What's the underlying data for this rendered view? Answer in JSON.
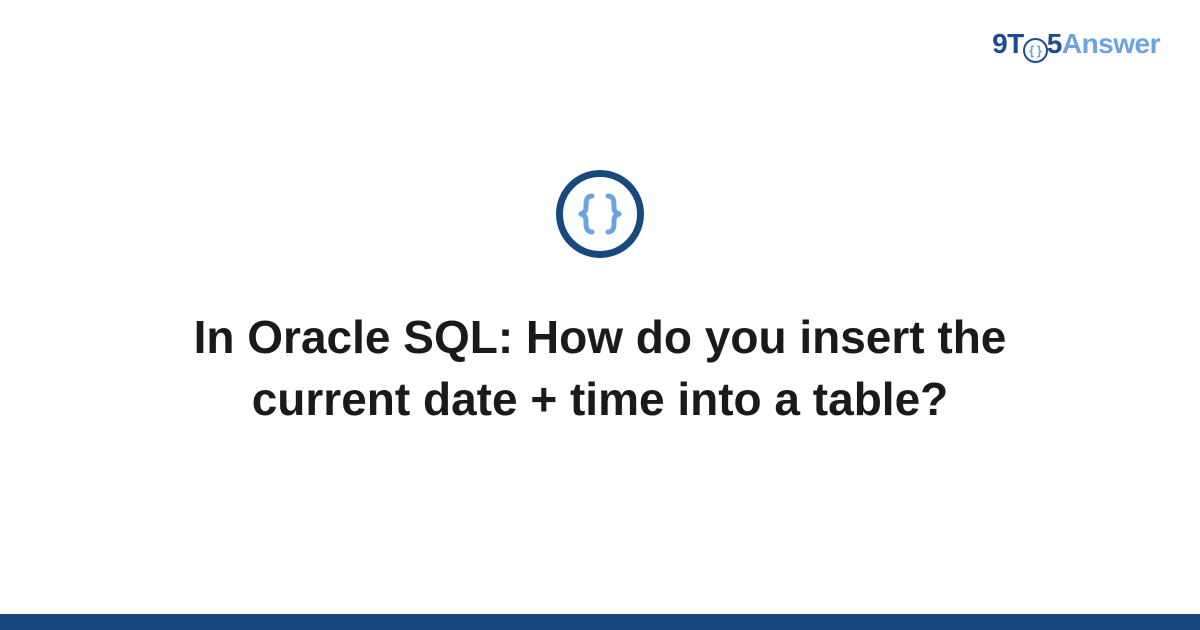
{
  "brand": {
    "part1": "9T",
    "part2": "5",
    "part3": "Answer",
    "circle_glyph": "{ }"
  },
  "icon": {
    "name": "code-braces-icon",
    "stroke_color": "#17497f",
    "glyph_color": "#6ba3e0"
  },
  "question": {
    "title": "In Oracle SQL: How do you insert the current date + time into a table?"
  },
  "colors": {
    "accent_dark": "#17497f",
    "accent_light": "#6ba3e0",
    "text": "#1a1a1a",
    "background": "#ffffff"
  }
}
